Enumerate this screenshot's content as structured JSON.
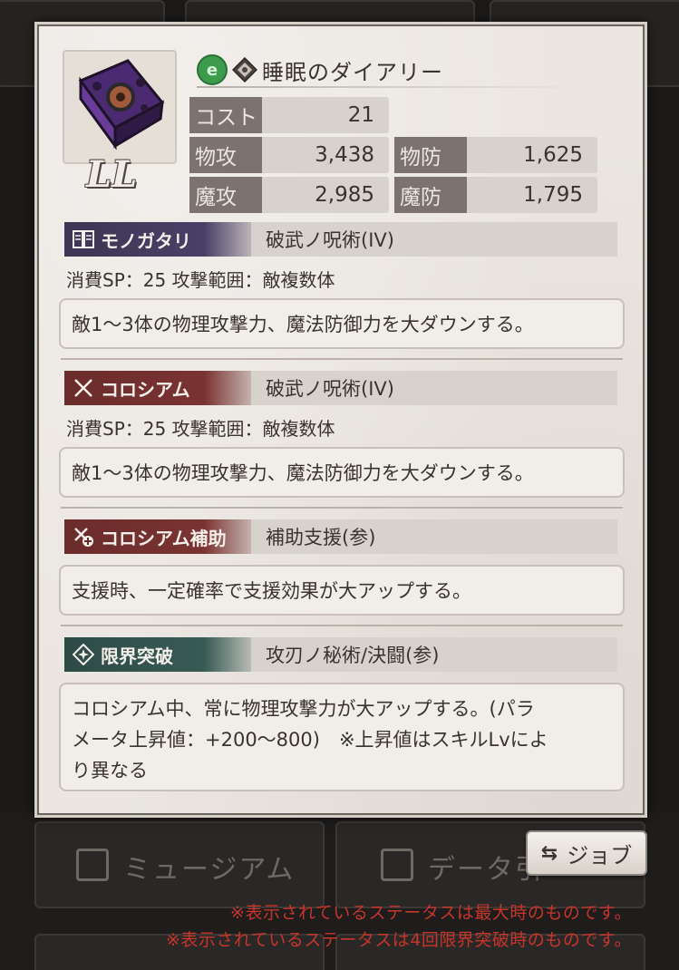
{
  "background": {
    "museum_label": "ミュージアム",
    "data_label": "データ引"
  },
  "item": {
    "name": "睡眠のダイアリー",
    "rank": "LL",
    "element_icon": "circle-e-icon",
    "type_icon": "diamond-book-icon"
  },
  "stats": {
    "cost": {
      "label": "コスト",
      "value": "21"
    },
    "patk": {
      "label": "物攻",
      "value": "3,438"
    },
    "pdef": {
      "label": "物防",
      "value": "1,625"
    },
    "matk": {
      "label": "魔攻",
      "value": "2,985"
    },
    "mdef": {
      "label": "魔防",
      "value": "1,795"
    }
  },
  "skills": [
    {
      "tag": "モノガタリ",
      "name": "破武ノ呪術(IV)",
      "meta": "消費SP：25 攻撃範囲：敵複数体",
      "desc": "敵1〜3体の物理攻撃力、魔法防御力を大ダウンする。"
    },
    {
      "tag": "コロシアム",
      "name": "破武ノ呪術(IV)",
      "meta": "消費SP：25 攻撃範囲：敵複数体",
      "desc": "敵1〜3体の物理攻撃力、魔法防御力を大ダウンする。"
    },
    {
      "tag": "コロシアム補助",
      "name": "補助支援(参)",
      "desc": "支援時、一定確率で支援効果が大アップする。"
    },
    {
      "tag": "限界突破",
      "name": "攻刃ノ秘術/決闘(参)",
      "desc_line1": "コロシアム中、常に物理攻撃力が大アップする。(パラ",
      "desc_line2": "メータ上昇値：+200〜800)　※上昇値はスキルLvによ",
      "desc_line3": "り異なる"
    }
  ],
  "job_button": {
    "label": "ジョブ",
    "icon": "swap-arrows-icon"
  },
  "notes": [
    "※表示されているステータスは最大時のものです。",
    "※表示されているステータスは4回限界突破時のものです。"
  ]
}
